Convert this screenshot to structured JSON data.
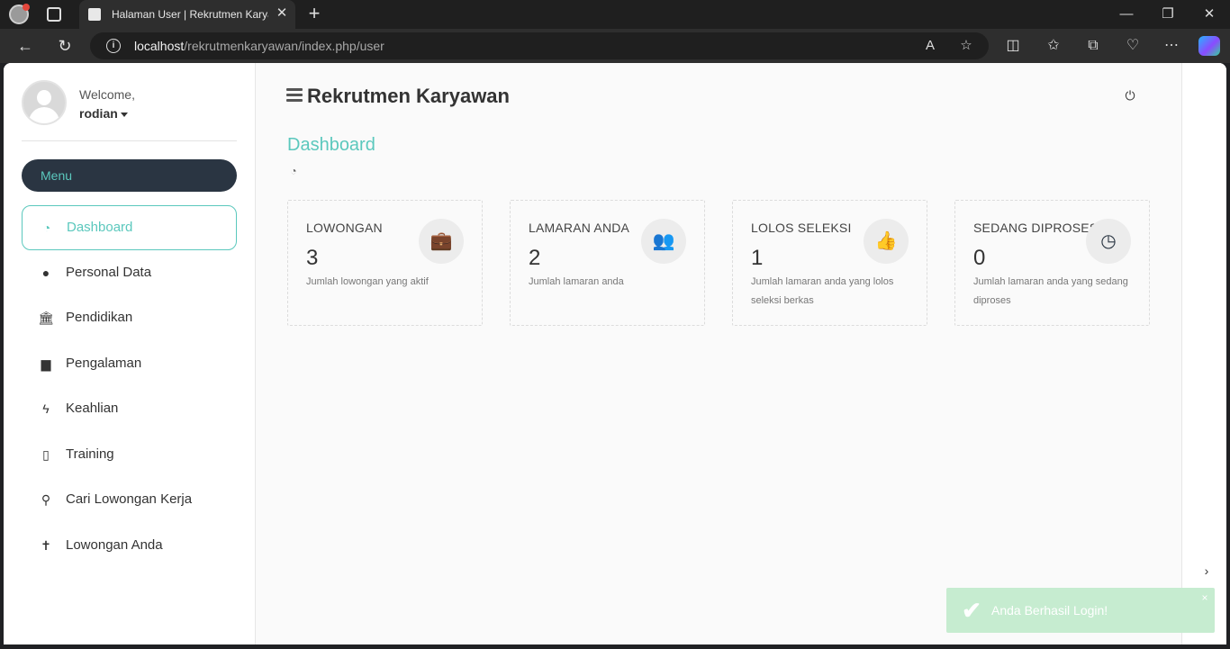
{
  "browser": {
    "tab_title": "Halaman User | Rekrutmen Karyawan",
    "tab_close": "✕",
    "new_tab": "+",
    "url_host": "localhost",
    "url_path": "/rekrutmenkaryawan/index.php/user",
    "icons": [
      "back-icon",
      "reload-icon",
      "site-info-icon",
      "read-aloud-icon",
      "favorite-icon",
      "split-screen-icon",
      "favorites-icon",
      "collections-icon",
      "health-icon",
      "more-icon",
      "copilot-icon"
    ]
  },
  "sidebar": {
    "welcome": "Welcome,",
    "username": "rodian",
    "menu_header": "Menu",
    "items": [
      {
        "label": "Dashboard",
        "icon": "dashboard-icon",
        "glyph": "◔",
        "active": true
      },
      {
        "label": "Personal Data",
        "icon": "user-icon",
        "glyph": "●",
        "active": false
      },
      {
        "label": "Pendidikan",
        "icon": "institution-icon",
        "glyph": "🏛",
        "active": false
      },
      {
        "label": "Pengalaman",
        "icon": "briefcase-icon",
        "glyph": "▆",
        "active": false
      },
      {
        "label": "Keahlian",
        "icon": "bolt-icon",
        "glyph": "ϟ",
        "active": false
      },
      {
        "label": "Training",
        "icon": "file-code-icon",
        "glyph": "▯",
        "active": false
      },
      {
        "label": "Cari Lowongan Kerja",
        "icon": "search-icon",
        "glyph": "⚲",
        "active": false
      },
      {
        "label": "Lowongan Anda",
        "icon": "child-icon",
        "glyph": "✝",
        "active": false
      }
    ]
  },
  "header": {
    "app_title": "Rekrutmen Karyawan",
    "power_glyph": "⏻"
  },
  "main": {
    "heading": "Dashboard",
    "heading_icon_glyph": "◔",
    "cards": [
      {
        "title": "LOWONGAN",
        "value": "3",
        "desc": "Jumlah lowongan yang aktif",
        "icon": "briefcase-icon",
        "glyph": "💼"
      },
      {
        "title": "LAMARAN ANDA",
        "value": "2",
        "desc": "Jumlah lamaran anda",
        "icon": "users-icon",
        "glyph": "👥"
      },
      {
        "title": "LOLOS SELEKSI",
        "value": "1",
        "desc": "Jumlah lamaran anda yang lolos seleksi berkas",
        "icon": "thumbs-up-icon",
        "glyph": "👍"
      },
      {
        "title": "SEDANG DIPROSES",
        "value": "0",
        "desc": "Jumlah lamaran anda yang sedang diproses",
        "icon": "clock-icon",
        "glyph": "◷"
      }
    ]
  },
  "rail": {
    "chevron": "›"
  },
  "toast": {
    "message": "Anda Berhasil Login!",
    "check": "✔",
    "close": "×"
  },
  "colors": {
    "accent": "#5bc8bd",
    "sidebar_menu_bg": "#2a3542",
    "toast_bg": "#c6ecd0"
  }
}
